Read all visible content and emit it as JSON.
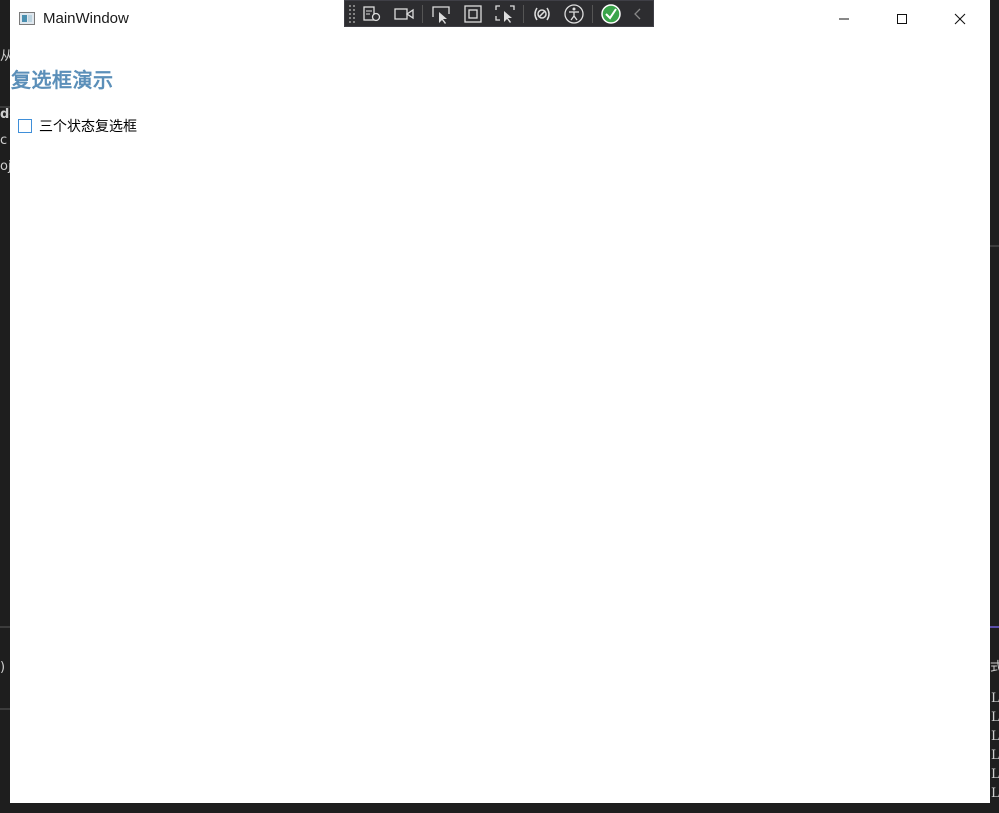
{
  "window": {
    "title": "MainWindow",
    "controls": {
      "minimize": "minimize",
      "maximize": "maximize",
      "close": "close"
    }
  },
  "devtoolbar": {
    "tools": [
      "live-visual-tree-icon",
      "record-icon",
      "select-element-icon",
      "display-layout-adorners-icon",
      "track-focus-icon",
      "binding-failures-icon",
      "accessibility-icon",
      "hot-reload-ok-icon",
      "collapse-chevron-icon"
    ]
  },
  "content": {
    "heading": "复选框演示",
    "checkbox": {
      "label": "三个状态复选框",
      "checked": false
    }
  },
  "background_fragments": {
    "left": [
      "从",
      "do",
      "c",
      "oj",
      ")"
    ],
    "right": [
      "式",
      "L",
      "L",
      "L",
      "L",
      "L",
      "L"
    ]
  },
  "colors": {
    "heading": "#5b8fb9",
    "checkbox_border": "#3f8fd9",
    "window_bg": "#ffffff",
    "desktop_bg": "#1e1e1e",
    "devbar_bg": "#2d2d30"
  }
}
